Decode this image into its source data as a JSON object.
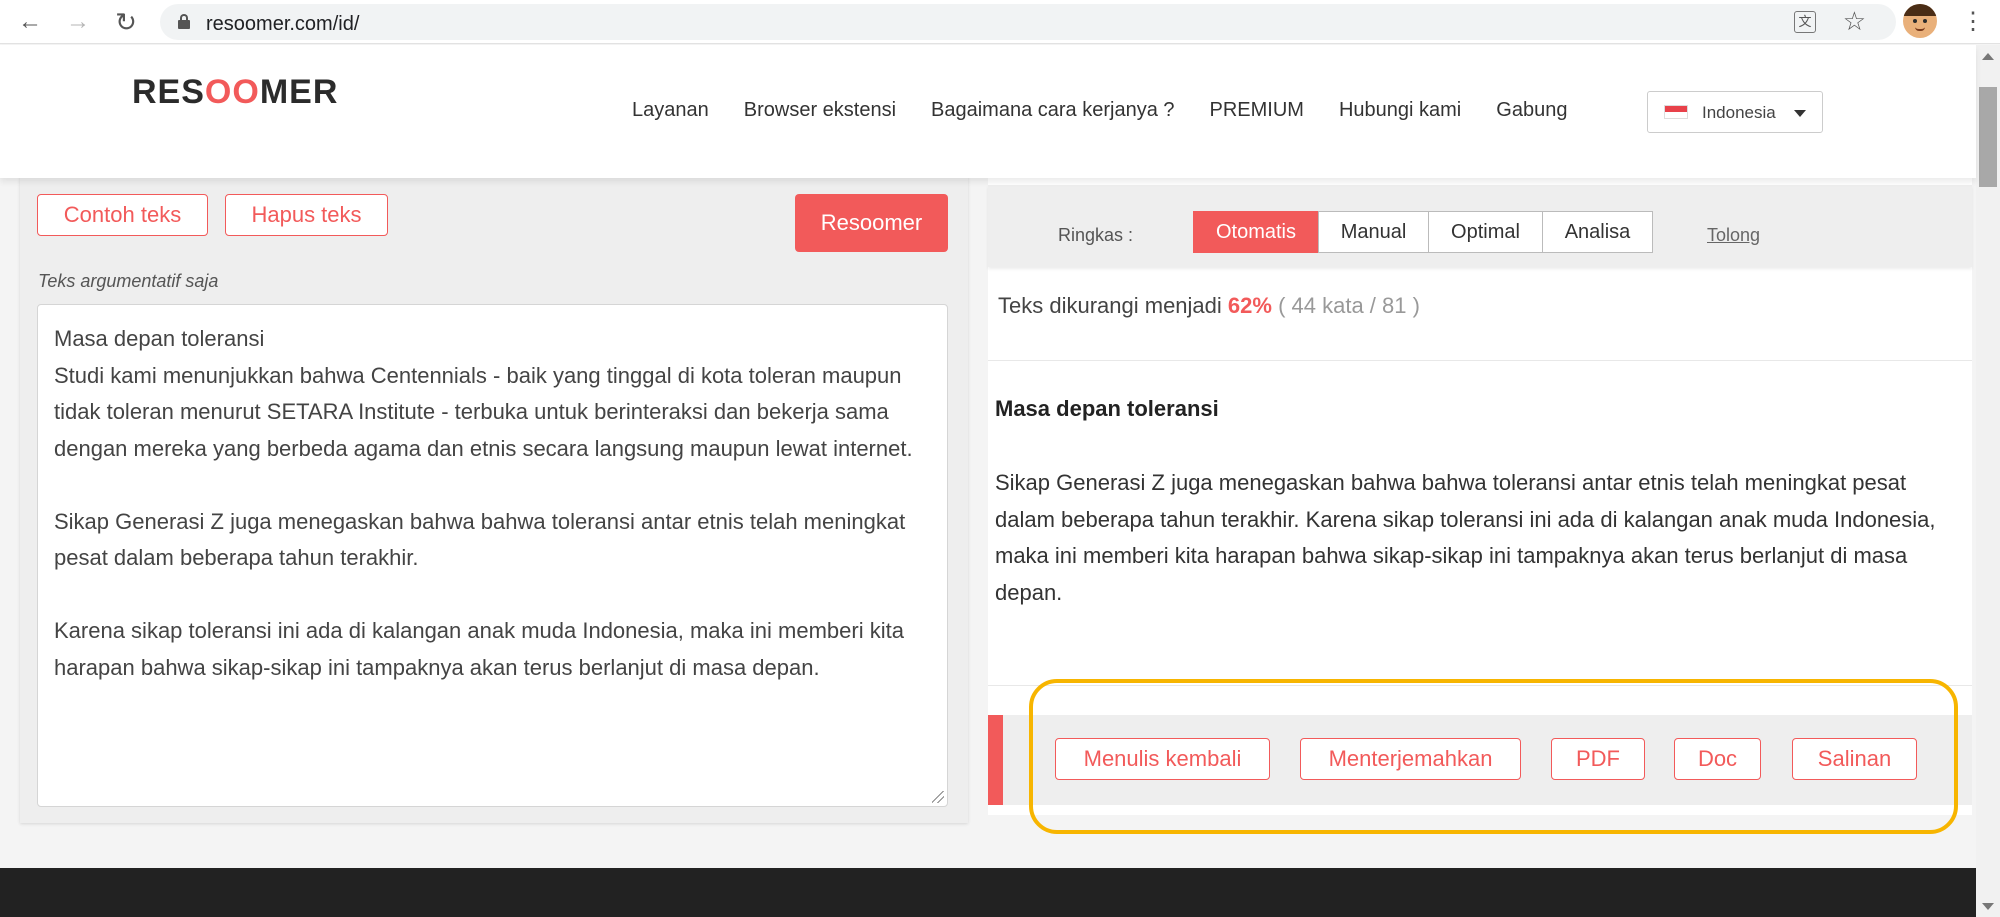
{
  "browser": {
    "url": "resoomer.com/id/",
    "back_icon": "←",
    "forward_icon": "→",
    "reload_icon": "↻",
    "translate_icon": "文",
    "star_icon": "☆",
    "menu_icon": "⋮"
  },
  "header": {
    "logo_pre": "RES",
    "logo_mid": "OO",
    "logo_post": "MER",
    "nav": [
      "Layanan",
      "Browser ekstensi",
      "Bagaimana cara kerjanya ?",
      "PREMIUM",
      "Hubungi kami",
      "Gabung"
    ],
    "language": "Indonesia"
  },
  "left": {
    "sample_button": "Contoh teks",
    "clear_button": "Hapus teks",
    "submit_button": "Resoomer",
    "hint": "Teks argumentatif saja",
    "input_paragraphs": [
      "Masa depan toleransi",
      "Studi kami menunjukkan bahwa Centennials - baik yang tinggal di kota toleran maupun tidak toleran menurut SETARA Institute - terbuka untuk berinteraksi dan bekerja sama dengan mereka yang berbeda agama dan etnis secara langsung maupun lewat internet.",
      "Sikap Generasi Z juga menegaskan bahwa bahwa toleransi antar etnis telah meningkat pesat dalam beberapa tahun terakhir.",
      "Karena sikap toleransi ini ada di kalangan anak muda Indonesia, maka ini memberi kita harapan bahwa sikap-sikap ini tampaknya akan terus berlanjut di masa depan."
    ]
  },
  "right": {
    "mode_label": "Ringkas :",
    "tabs": [
      "Otomatis",
      "Manual",
      "Optimal",
      "Analisa"
    ],
    "active_tab": "Otomatis",
    "help_link": "Tolong",
    "reduced_prefix": "Teks dikurangi menjadi",
    "reduced_percent": "62%",
    "reduced_count": "( 44 kata / 81 )",
    "summary_title": "Masa depan toleransi",
    "summary_body": "Sikap Generasi Z juga menegaskan bahwa bahwa toleransi antar etnis telah meningkat pesat dalam beberapa tahun terakhir. Karena sikap toleransi ini ada di kalangan anak muda Indonesia, maka ini memberi kita harapan bahwa sikap-sikap ini tampaknya akan terus berlanjut di masa depan.",
    "actions": [
      "Menulis kembali",
      "Menterjemahkan",
      "PDF",
      "Doc",
      "Salinan"
    ]
  },
  "colors": {
    "accent": "#f25a5a",
    "highlight": "#f7b500",
    "footer": "#222222"
  }
}
